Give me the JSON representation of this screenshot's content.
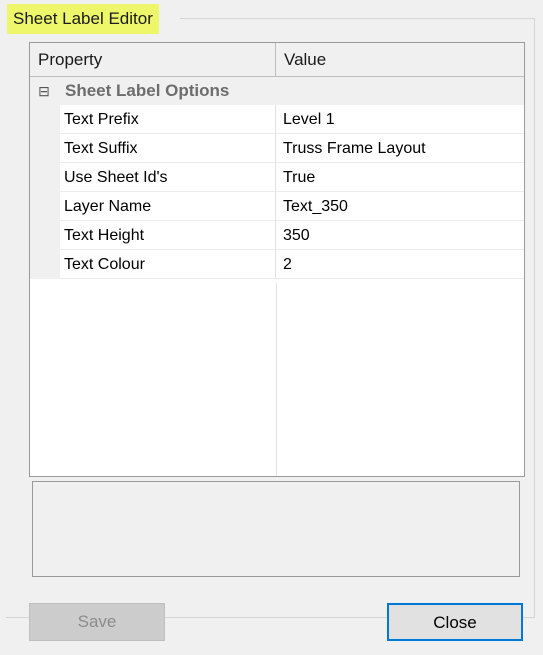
{
  "window": {
    "title": "Sheet Label Editor"
  },
  "grid": {
    "columns": {
      "property": "Property",
      "value": "Value"
    },
    "category": {
      "expander_symbol": "⊟",
      "label": "Sheet Label Options"
    },
    "rows": [
      {
        "name": "Text Prefix",
        "value": "Level 1"
      },
      {
        "name": "Text Suffix",
        "value": "Truss Frame Layout"
      },
      {
        "name": "Use Sheet Id's",
        "value": "True"
      },
      {
        "name": "Layer Name",
        "value": "Text_350"
      },
      {
        "name": "Text Height",
        "value": "350"
      },
      {
        "name": "Text Colour",
        "value": "2"
      }
    ]
  },
  "description": {
    "text": ""
  },
  "buttons": {
    "save_label": "Save",
    "close_label": "Close"
  },
  "colors": {
    "title_highlight": "#eef66a",
    "focus_border": "#0078d7",
    "disabled_button": "#cccccc",
    "category_text": "#6d6d6d"
  }
}
